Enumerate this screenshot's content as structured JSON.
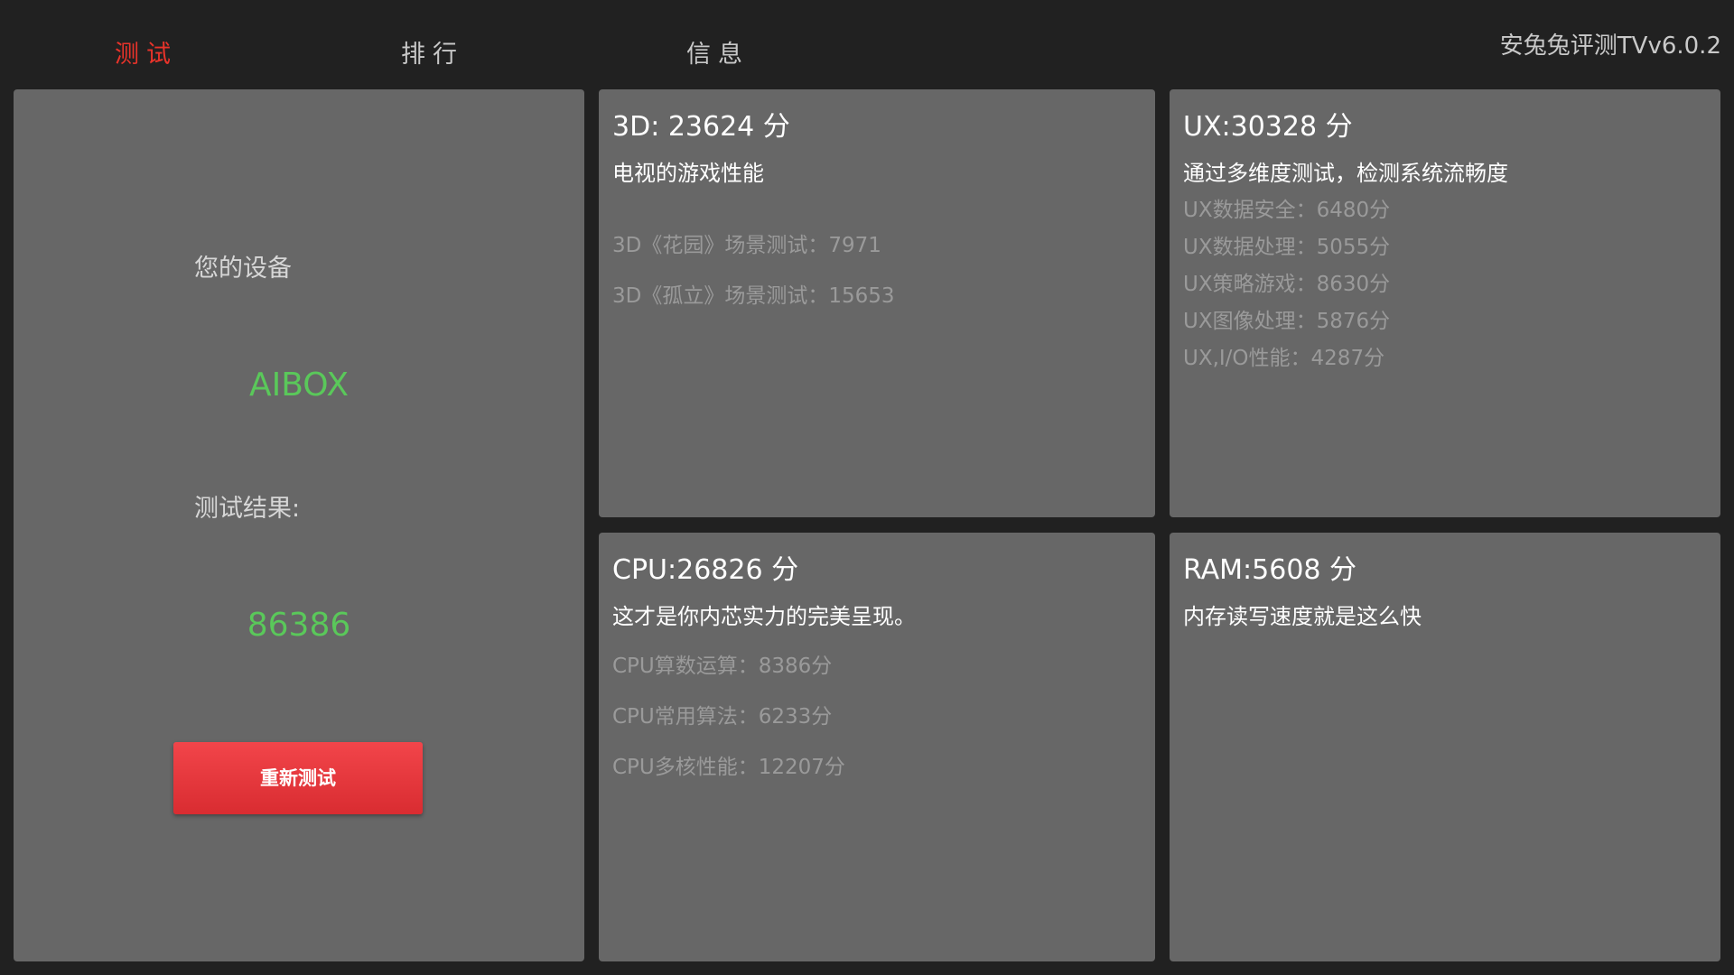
{
  "tabs": [
    {
      "label": "测试",
      "active": true
    },
    {
      "label": "排行",
      "active": false
    },
    {
      "label": "信息",
      "active": false
    }
  ],
  "app_title": "安兔兔评测TVv6.0.2",
  "device_panel": {
    "device_label": "您的设备",
    "device_name": "AIBOX",
    "result_label": "测试结果:",
    "total_score": "86386",
    "retest_label": "重新测试"
  },
  "cards": {
    "gpu": {
      "title": "3D: 23624 分",
      "subtitle": "电视的游戏性能",
      "items": [
        "3D《花园》场景测试：7971",
        "3D《孤立》场景测试：15653"
      ]
    },
    "ux": {
      "title": "UX:30328 分",
      "subtitle": "通过多维度测试，检测系统流畅度",
      "items": [
        "UX数据安全：6480分",
        "UX数据处理：5055分",
        "UX策略游戏：8630分",
        "UX图像处理：5876分",
        "UX,I/O性能：4287分"
      ]
    },
    "cpu": {
      "title": "CPU:26826 分",
      "subtitle": "这才是你内芯实力的完美呈现。",
      "items": [
        "CPU算数运算：8386分",
        "CPU常用算法：6233分",
        "CPU多核性能：12207分"
      ]
    },
    "ram": {
      "title": "RAM:5608 分",
      "subtitle": "内存读写速度就是这么快"
    }
  },
  "colors": {
    "background": "#212121",
    "panel": "#676767",
    "active_tab": "#e8332a",
    "score_green": "#5ac85a",
    "button_red": "#e3373c"
  }
}
